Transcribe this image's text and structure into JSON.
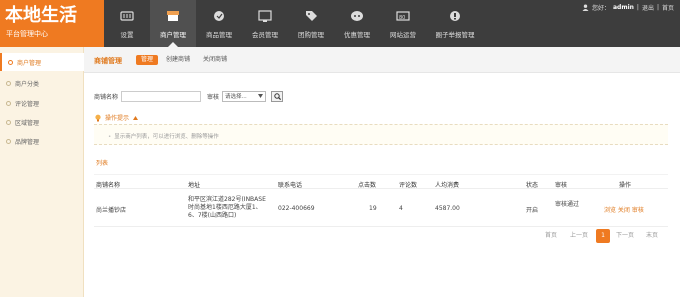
{
  "logo": {
    "title": "本地生活",
    "subtitle": "平台管理中心"
  },
  "nav": [
    {
      "label": "设置",
      "icon": "settings-icon"
    },
    {
      "label": "商户管理",
      "icon": "shop-icon",
      "active": true
    },
    {
      "label": "商品管理",
      "icon": "goods-icon"
    },
    {
      "label": "会员管理",
      "icon": "member-icon"
    },
    {
      "label": "团购管理",
      "icon": "tag-icon"
    },
    {
      "label": "优惠管理",
      "icon": "coupon-icon"
    },
    {
      "label": "网站运营",
      "icon": "site-icon"
    },
    {
      "label": "圈子举报管理",
      "icon": "circle-report-icon"
    }
  ],
  "user": {
    "greeting": "您好：",
    "name": "admin",
    "sep1": "|",
    "logout": "退出",
    "sep2": "|",
    "home": "首页"
  },
  "sidebar": [
    {
      "label": "商户管理",
      "active": true
    },
    {
      "label": "商户分类"
    },
    {
      "label": "评论管理"
    },
    {
      "label": "区域管理"
    },
    {
      "label": "品牌管理"
    }
  ],
  "page": {
    "title": "商铺管理",
    "tabs": [
      {
        "label": "管理",
        "active": true
      },
      {
        "label": "创建商铺"
      },
      {
        "label": "关闭商铺"
      }
    ]
  },
  "search": {
    "name_label": "商铺名称",
    "name_value": "",
    "audit_label": "审核",
    "audit_selected": "请选择...",
    "search_icon": "search-icon"
  },
  "tips": {
    "title": "操作提示",
    "text": "显示商户列表，可以进行浏览、删除等操作"
  },
  "list": {
    "label": "列表",
    "headers": [
      "商铺名称",
      "地址",
      "联系电话",
      "点击数",
      "评论数",
      "人均消费",
      "状态",
      "审核",
      "操作"
    ],
    "rows": [
      {
        "name": "尚兰播钞店",
        "address": "和平区滨江道282号(INBASE时尚基地1楼西厄路大厦1、6、7楼(山西路口)",
        "phone": "022-400669",
        "clicks": "19",
        "comments": "4",
        "avg_spend": "4587.00",
        "status": "开启",
        "audit": "审核通过",
        "ops": "浏览 关闭 审核"
      }
    ]
  },
  "pagination": {
    "first": "首页",
    "prev": "上一页",
    "current": "1",
    "next": "下一页",
    "last": "末页"
  },
  "colors": {
    "accent": "#ef7a21",
    "topbar": "#3d3d3d",
    "sidebar": "#fbf3e3"
  }
}
